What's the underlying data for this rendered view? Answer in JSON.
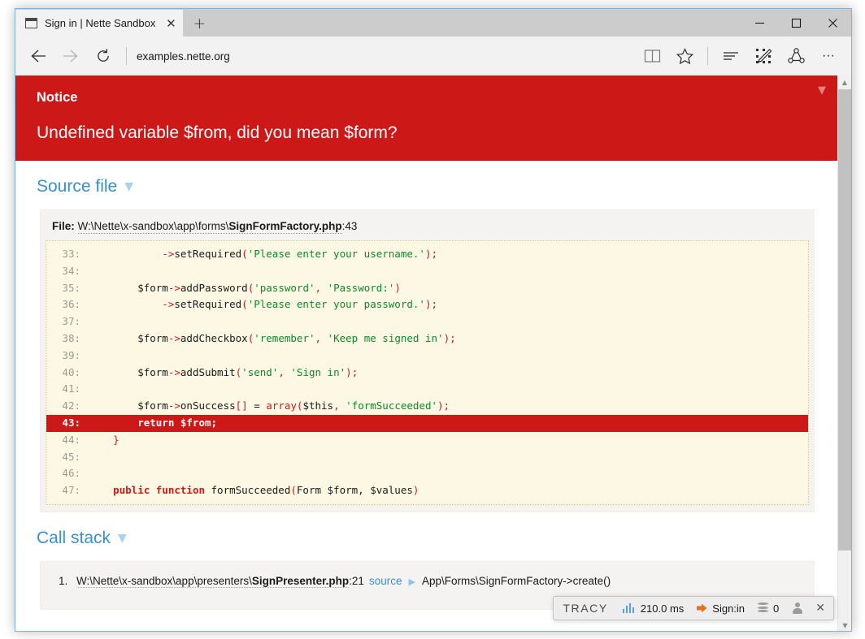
{
  "browser": {
    "tab": {
      "title": "Sign in | Nette Sandbox",
      "close_label": "✕",
      "favicon_name": "page-icon"
    },
    "newtab_label": "+",
    "window_controls": {
      "minimize": "—",
      "maximize": "☐",
      "close": "✕"
    },
    "nav": {
      "back": "←",
      "forward": "→",
      "refresh": "↻",
      "url": "examples.nette.org",
      "reading_view": "book-icon",
      "favorites": "star-icon",
      "hub": "hub-icon",
      "web_note": "web-note-icon",
      "share": "share-icon",
      "more": "···"
    }
  },
  "notice": {
    "label": "Notice",
    "message": "Undefined variable $from, did you mean $form?",
    "toggle": "▼",
    "bg_color": "#cd1818"
  },
  "source_file": {
    "heading": "Source file",
    "caret": "▼",
    "file_label": "File:",
    "file_path": "W:\\Nette\\x-sandbox\\app\\forms\\",
    "file_name": "SignFormFactory.php",
    "file_line": ":43",
    "highlight_line": 43,
    "lines": [
      {
        "n": "33:",
        "parts": [
          {
            "t": "            ->",
            "c": "tok-punc"
          },
          {
            "t": "setRequired",
            "c": ""
          },
          {
            "t": "(",
            "c": "tok-punc"
          },
          {
            "t": "'Please enter your username.'",
            "c": "tok-str"
          },
          {
            "t": ");",
            "c": "tok-punc"
          }
        ]
      },
      {
        "n": "34:",
        "parts": [
          {
            "t": "",
            "c": ""
          }
        ]
      },
      {
        "n": "35:",
        "parts": [
          {
            "t": "        $form",
            "c": ""
          },
          {
            "t": "->",
            "c": "tok-punc"
          },
          {
            "t": "addPassword",
            "c": ""
          },
          {
            "t": "(",
            "c": "tok-punc"
          },
          {
            "t": "'password'",
            "c": "tok-str"
          },
          {
            "t": ", ",
            "c": "tok-punc"
          },
          {
            "t": "'Password:'",
            "c": "tok-str"
          },
          {
            "t": ")",
            "c": "tok-punc"
          }
        ]
      },
      {
        "n": "36:",
        "parts": [
          {
            "t": "            ->",
            "c": "tok-punc"
          },
          {
            "t": "setRequired",
            "c": ""
          },
          {
            "t": "(",
            "c": "tok-punc"
          },
          {
            "t": "'Please enter your password.'",
            "c": "tok-str"
          },
          {
            "t": ");",
            "c": "tok-punc"
          }
        ]
      },
      {
        "n": "37:",
        "parts": [
          {
            "t": "",
            "c": ""
          }
        ]
      },
      {
        "n": "38:",
        "parts": [
          {
            "t": "        $form",
            "c": ""
          },
          {
            "t": "->",
            "c": "tok-punc"
          },
          {
            "t": "addCheckbox",
            "c": ""
          },
          {
            "t": "(",
            "c": "tok-punc"
          },
          {
            "t": "'remember'",
            "c": "tok-str"
          },
          {
            "t": ", ",
            "c": "tok-punc"
          },
          {
            "t": "'Keep me signed in'",
            "c": "tok-str"
          },
          {
            "t": ");",
            "c": "tok-punc"
          }
        ]
      },
      {
        "n": "39:",
        "parts": [
          {
            "t": "",
            "c": ""
          }
        ]
      },
      {
        "n": "40:",
        "parts": [
          {
            "t": "        $form",
            "c": ""
          },
          {
            "t": "->",
            "c": "tok-punc"
          },
          {
            "t": "addSubmit",
            "c": ""
          },
          {
            "t": "(",
            "c": "tok-punc"
          },
          {
            "t": "'send'",
            "c": "tok-str"
          },
          {
            "t": ", ",
            "c": "tok-punc"
          },
          {
            "t": "'Sign in'",
            "c": "tok-str"
          },
          {
            "t": ");",
            "c": "tok-punc"
          }
        ]
      },
      {
        "n": "41:",
        "parts": [
          {
            "t": "",
            "c": ""
          }
        ]
      },
      {
        "n": "42:",
        "parts": [
          {
            "t": "        $form",
            "c": ""
          },
          {
            "t": "->",
            "c": "tok-punc"
          },
          {
            "t": "onSuccess",
            "c": ""
          },
          {
            "t": "[]",
            "c": "tok-punc"
          },
          {
            "t": " = ",
            "c": ""
          },
          {
            "t": "array(",
            "c": "tok-punc"
          },
          {
            "t": "$this",
            "c": ""
          },
          {
            "t": ", ",
            "c": "tok-punc"
          },
          {
            "t": "'formSucceeded'",
            "c": "tok-str"
          },
          {
            "t": ");",
            "c": "tok-punc"
          }
        ]
      },
      {
        "n": "43:",
        "hl": true,
        "parts": [
          {
            "t": "        return $from;",
            "c": ""
          }
        ]
      },
      {
        "n": "44:",
        "parts": [
          {
            "t": "    ",
            "c": ""
          },
          {
            "t": "}",
            "c": "tok-punc"
          }
        ]
      },
      {
        "n": "45:",
        "parts": [
          {
            "t": "",
            "c": ""
          }
        ]
      },
      {
        "n": "46:",
        "parts": [
          {
            "t": "",
            "c": ""
          }
        ]
      },
      {
        "n": "47:",
        "parts": [
          {
            "t": "    ",
            "c": ""
          },
          {
            "t": "public function",
            "c": "tok-kw"
          },
          {
            "t": " formSucceeded",
            "c": ""
          },
          {
            "t": "(",
            "c": "tok-punc"
          },
          {
            "t": "Form $form, $values",
            "c": ""
          },
          {
            "t": ")",
            "c": "tok-punc"
          }
        ]
      }
    ]
  },
  "call_stack": {
    "heading": "Call stack",
    "caret": "▼",
    "rows": [
      {
        "index": "1.",
        "path": "W:\\Nette\\x-sandbox\\app\\presenters\\",
        "file": "SignPresenter.php",
        "line": ":21",
        "source_link": "source",
        "play": "▶",
        "call": "App\\Forms\\SignFormFactory->create()"
      }
    ]
  },
  "tracy_bar": {
    "logo": "TRACY",
    "time": "210.0 ms",
    "route": "Sign:in",
    "queries": "0",
    "close": "✕",
    "bar_icon_name": "bar-chart-icon",
    "route_icon_name": "orange-arrow-icon",
    "db_icon_name": "database-icon",
    "user_icon_name": "user-icon"
  }
}
